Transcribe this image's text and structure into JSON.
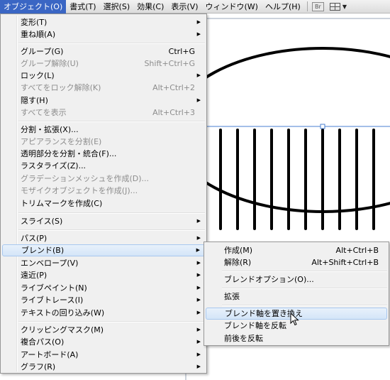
{
  "menubar": {
    "items": [
      "オブジェクト(O)",
      "書式(T)",
      "選択(S)",
      "効果(C)",
      "表示(V)",
      "ウィンドウ(W)",
      "ヘルプ(H)"
    ],
    "bridge_label": "Br"
  },
  "object_menu": [
    {
      "label": "変形(T)",
      "submenu": true
    },
    {
      "label": "重ね順(A)",
      "submenu": true
    },
    {
      "label": "グループ(G)",
      "shortcut": "Ctrl+G"
    },
    {
      "label": "グループ解除(U)",
      "shortcut": "Shift+Ctrl+G",
      "disabled": true
    },
    {
      "label": "ロック(L)",
      "submenu": true
    },
    {
      "label": "すべてをロック解除(K)",
      "shortcut": "Alt+Ctrl+2",
      "disabled": true
    },
    {
      "label": "隠す(H)",
      "submenu": true
    },
    {
      "label": "すべてを表示",
      "shortcut": "Alt+Ctrl+3",
      "disabled": true
    },
    {
      "label": "分割・拡張(X)..."
    },
    {
      "label": "アピアランスを分割(E)",
      "disabled": true
    },
    {
      "label": "透明部分を分割・統合(F)..."
    },
    {
      "label": "ラスタライズ(Z)..."
    },
    {
      "label": "グラデーションメッシュを作成(D)...",
      "disabled": true
    },
    {
      "label": "モザイクオブジェクトを作成(J)...",
      "disabled": true
    },
    {
      "label": "トリムマークを作成(C)"
    },
    {
      "label": "スライス(S)",
      "submenu": true
    },
    {
      "label": "パス(P)",
      "submenu": true
    },
    {
      "label": "ブレンド(B)",
      "submenu": true,
      "active": true
    },
    {
      "label": "エンベロープ(V)",
      "submenu": true
    },
    {
      "label": "遠近(P)",
      "submenu": true
    },
    {
      "label": "ライブペイント(N)",
      "submenu": true
    },
    {
      "label": "ライブトレース(I)",
      "submenu": true
    },
    {
      "label": "テキストの回り込み(W)",
      "submenu": true
    },
    {
      "label": "クリッピングマスク(M)",
      "submenu": true
    },
    {
      "label": "複合パス(O)",
      "submenu": true
    },
    {
      "label": "アートボード(A)",
      "submenu": true
    },
    {
      "label": "グラフ(R)",
      "submenu": true
    }
  ],
  "blend_submenu": [
    {
      "label": "作成(M)",
      "shortcut": "Alt+Ctrl+B"
    },
    {
      "label": "解除(R)",
      "shortcut": "Alt+Shift+Ctrl+B"
    },
    {
      "label": "ブレンドオプション(O)..."
    },
    {
      "label": "拡張"
    },
    {
      "label": "ブレンド軸を置き換え",
      "hover": true
    },
    {
      "label": "ブレンド軸を反転"
    },
    {
      "label": "前後を反転"
    }
  ],
  "colors": {
    "menubar_active": "#3a66c4",
    "highlight": "#d4e5f8",
    "guide_blue": "#4a7fd0"
  }
}
